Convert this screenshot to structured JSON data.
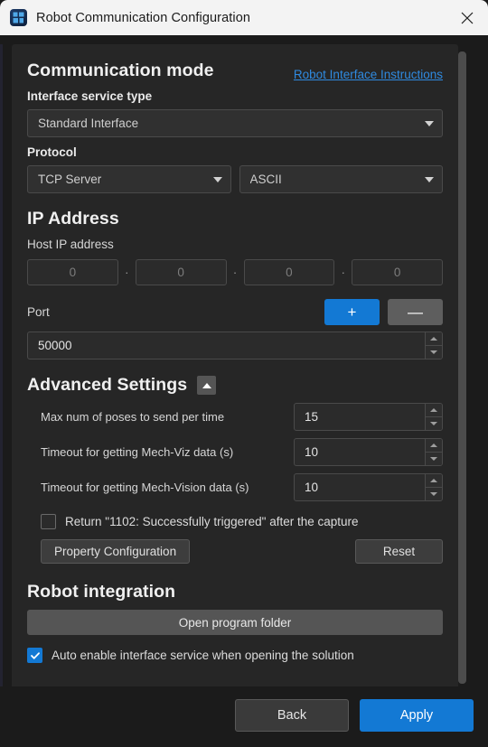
{
  "window": {
    "title": "Robot Communication Configuration",
    "icon": "mech-mind-logo-icon",
    "close_label": "✕"
  },
  "communication_mode": {
    "heading": "Communication mode",
    "instructions_link": "Robot Interface Instructions",
    "interface_service_type_label": "Interface service type",
    "interface_service_type_value": "Standard Interface",
    "protocol_label": "Protocol",
    "protocol_value": "TCP Server",
    "format_value": "ASCII"
  },
  "ip_address": {
    "heading": "IP Address",
    "host_ip_label": "Host IP address",
    "octets": [
      "0",
      "0",
      "0",
      "0"
    ],
    "separator": "·",
    "port_label": "Port",
    "add_button": "+",
    "remove_button": "—",
    "port_value": "50000"
  },
  "advanced_settings": {
    "heading": "Advanced Settings",
    "collapse_icon": "chevron-up-icon",
    "rows": [
      {
        "label": "Max num of poses to send per time",
        "value": "15"
      },
      {
        "label": "Timeout for getting Mech-Viz data (s)",
        "value": "10"
      },
      {
        "label": "Timeout for getting Mech-Vision data (s)",
        "value": "10"
      }
    ],
    "return_checkbox_label": "Return \"1102: Successfully triggered\" after the capture",
    "return_checkbox_checked": false,
    "property_configuration_button": "Property Configuration",
    "reset_button": "Reset"
  },
  "robot_integration": {
    "heading": "Robot integration",
    "open_program_folder_button": "Open program folder",
    "auto_enable_label": "Auto enable interface service when opening the solution",
    "auto_enable_checked": true
  },
  "footer": {
    "back_button": "Back",
    "apply_button": "Apply"
  },
  "colors": {
    "accent_blue": "#1379d4",
    "link_blue": "#2f8ae0",
    "panel_bg": "#262626",
    "window_bg": "#1b1b1b",
    "titlebar_bg": "#f3f3f3"
  }
}
